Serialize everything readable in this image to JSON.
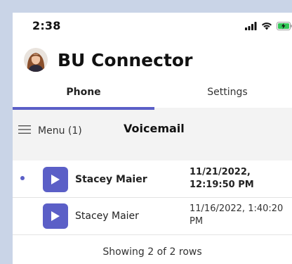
{
  "status_bar": {
    "time": "2:38",
    "icons": [
      "signal-icon",
      "wifi-icon",
      "battery-charging-icon"
    ]
  },
  "app": {
    "title": "BU Connector"
  },
  "tabs": [
    {
      "label": "Phone",
      "selected": true
    },
    {
      "label": "Settings",
      "selected": false
    }
  ],
  "colors": {
    "accent": "#5b5fc7",
    "outer_background": "#c9d4e7",
    "content_background": "#f3f3f3"
  },
  "menu": {
    "label": "Menu (1)"
  },
  "section": {
    "title": "Voicemail"
  },
  "voicemails": [
    {
      "caller": "Stacey Maier",
      "datetime": "11/21/2022, 12:19:50 PM",
      "unread": true
    },
    {
      "caller": "Stacey Maier",
      "datetime": "11/16/2022, 1:40:20 PM",
      "unread": false
    }
  ],
  "footer": {
    "text": "Showing 2 of 2 rows"
  }
}
